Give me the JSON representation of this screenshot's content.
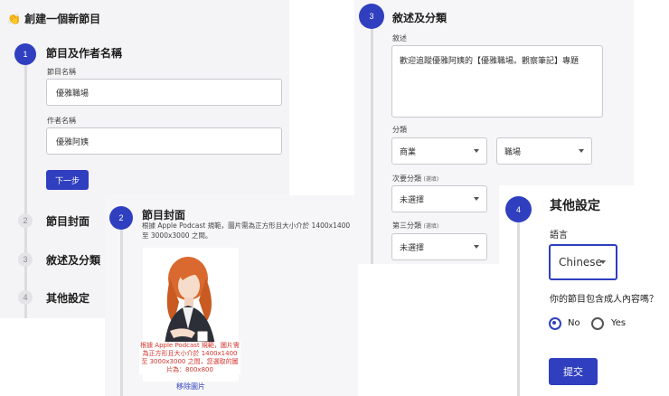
{
  "page_title": "👏 創建一個新節目",
  "steps": {
    "s1": {
      "num": "1",
      "title": "節目及作者名稱"
    },
    "s2": {
      "num": "2",
      "title": "節目封面"
    },
    "s3": {
      "num": "3",
      "title": "敘述及分類"
    },
    "s4": {
      "num": "4",
      "title": "其他設定"
    }
  },
  "form1": {
    "show_name_label": "節目名稱",
    "show_name_value": "優雅職場",
    "author_label": "作者名稱",
    "author_value": "優雅阿姨",
    "next_button": "下一步"
  },
  "cover": {
    "description": "根據 Apple Podcast 規範，圖片需為正方形且大小介於 1400x1400 至 3000x3000 之間。",
    "warning": "根據 Apple Podcast 規範，圖片需為正方形且大小介於 1400x1400 至 3000x3000 之間，您選取的圖片為：800x800",
    "remove_link": "移除圖片"
  },
  "form3": {
    "desc_label": "敘述",
    "desc_value": "歡迎追蹤優雅阿姨的【優雅職場。觀察筆記】專題",
    "category_label": "分類",
    "category_value": "商業",
    "subcategory_value": "職場",
    "second_label": "次要分類",
    "second_hint": "(選填)",
    "second_value": "未選擇",
    "third_label": "第三分類",
    "third_hint": "(選填)",
    "third_value": "未選擇"
  },
  "form4": {
    "language_label": "語言",
    "language_value": "Chinese",
    "adult_question": "你的節目包含成人內容嗎？",
    "option_no": "No",
    "option_yes": "Yes",
    "adult_selected": "No",
    "submit_button": "提交"
  },
  "colors": {
    "accent": "#2f3fbf",
    "warning": "#d0342c"
  }
}
